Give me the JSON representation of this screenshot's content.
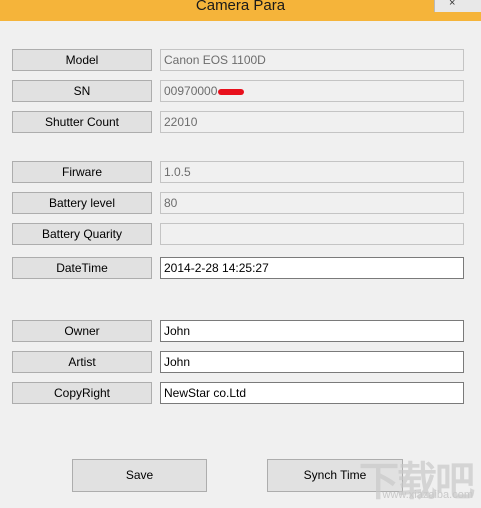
{
  "window": {
    "title": "Camera Para",
    "close_glyph": "×"
  },
  "rows": [
    {
      "key": "model",
      "label": "Model",
      "value": "Canon EOS 1100D",
      "editable": false
    },
    {
      "key": "sn",
      "label": "SN",
      "value": "00970000",
      "editable": false
    },
    {
      "key": "shutter_count",
      "label": "Shutter Count",
      "value": "22010",
      "editable": false
    },
    {
      "key": "firware",
      "label": "Firware",
      "value": "1.0.5",
      "editable": false
    },
    {
      "key": "battery_level",
      "label": "Battery level",
      "value": "80",
      "editable": false
    },
    {
      "key": "battery_quarity",
      "label": "Battery Quarity",
      "value": "",
      "editable": false
    },
    {
      "key": "datetime",
      "label": "DateTime",
      "value": "2014-2-28 14:25:27",
      "editable": true
    },
    {
      "key": "owner",
      "label": "Owner",
      "value": "John",
      "editable": true
    },
    {
      "key": "artist",
      "label": "Artist",
      "value": "John",
      "editable": true
    },
    {
      "key": "copyright",
      "label": "CopyRight",
      "value": "NewStar co.Ltd",
      "editable": true
    }
  ],
  "buttons": {
    "save": "Save",
    "synch_time": "Synch Time"
  },
  "watermark": {
    "text": "下载吧",
    "url": "www.xiazaiba.com"
  },
  "colors": {
    "titlebar": "#f5b43a",
    "redaction": "#e8101c"
  }
}
